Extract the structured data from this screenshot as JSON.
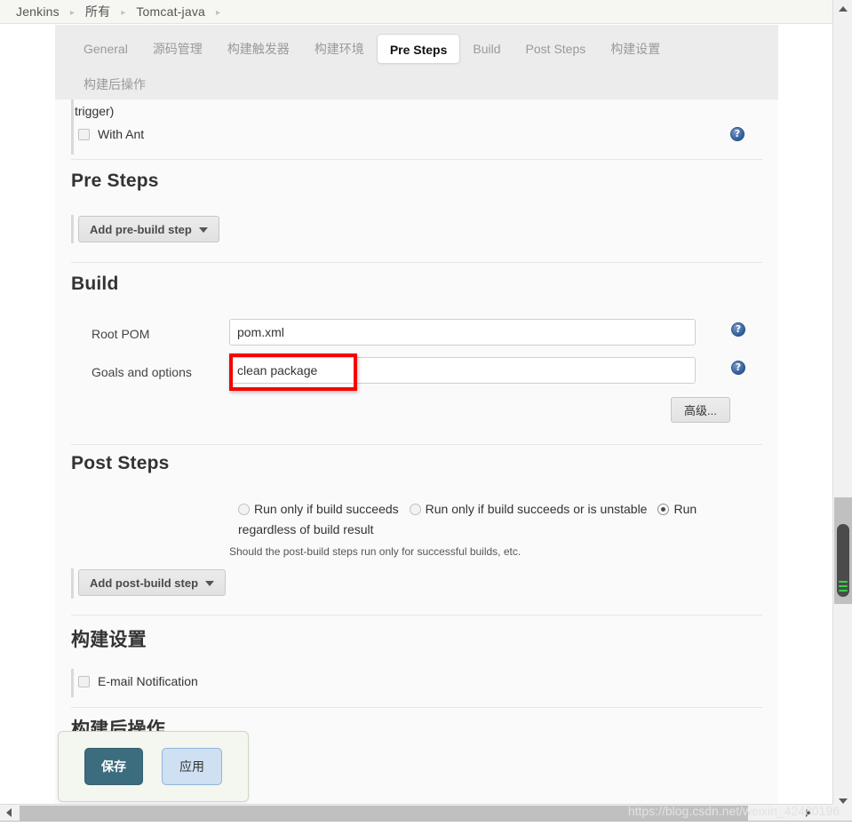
{
  "breadcrumb": {
    "items": [
      "Jenkins",
      "所有",
      "Tomcat-java"
    ],
    "separator": "▸"
  },
  "tabs": {
    "row1": [
      {
        "label": "General",
        "active": false
      },
      {
        "label": "源码管理",
        "active": false
      },
      {
        "label": "构建触发器",
        "active": false
      },
      {
        "label": "构建环境",
        "active": false
      },
      {
        "label": "Pre Steps",
        "active": true
      },
      {
        "label": "Build",
        "active": false
      },
      {
        "label": "Post Steps",
        "active": false
      },
      {
        "label": "构建设置",
        "active": false
      }
    ],
    "row2": [
      {
        "label": "构建后操作",
        "active": false
      }
    ]
  },
  "build_environment": {
    "trailing_text": "trigger)",
    "with_ant_label": "With Ant",
    "with_ant_checked": false
  },
  "pre_steps": {
    "title": "Pre Steps",
    "add_button_label": "Add pre-build step"
  },
  "build": {
    "title": "Build",
    "root_pom_label": "Root POM",
    "root_pom_value": "pom.xml",
    "goals_label": "Goals and options",
    "goals_value": "clean package",
    "advanced_button_label": "高级..."
  },
  "post_steps": {
    "title": "Post Steps",
    "radios": [
      {
        "label": "Run only if build succeeds",
        "checked": false
      },
      {
        "label": "Run only if build succeeds or is unstable",
        "checked": false
      },
      {
        "label": "Run regardless of build result",
        "checked": true
      }
    ],
    "hint": "Should the post-build steps run only for successful builds, etc.",
    "add_button_label": "Add post-build step"
  },
  "build_settings": {
    "title": "构建设置",
    "email_notification_label": "E-mail Notification",
    "email_notification_checked": false
  },
  "post_build_actions": {
    "title": "构建后操作"
  },
  "save_bar": {
    "save_label": "保存",
    "apply_label": "应用",
    "ghost_label": "后操"
  },
  "annotation": {
    "highlight_color": "#f60000",
    "target": "goals-and-options-input"
  },
  "help_icon": {
    "glyph": "?"
  },
  "watermark": {
    "text": "https://blog.csdn.net/weixin_42480196"
  },
  "colors": {
    "accent_save": "#3c6d7e",
    "accent_apply": "#cfe0f2",
    "help_blue": "#2e5d9e",
    "panel_bg": "#fafafa",
    "tabstrip_bg": "#ececec",
    "breadcrumb_bg": "#f6f7f2"
  }
}
